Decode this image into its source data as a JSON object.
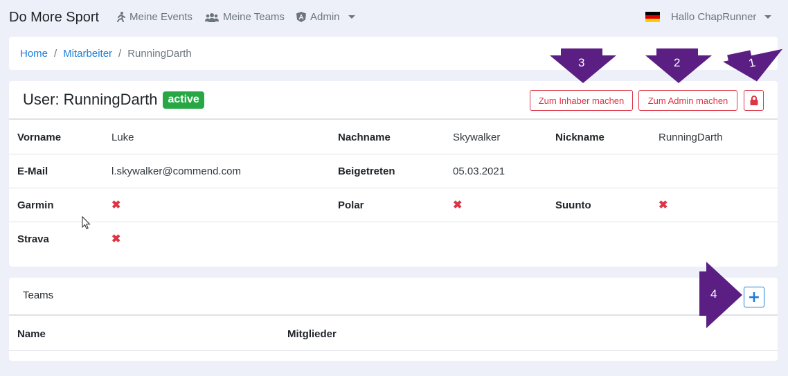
{
  "navbar": {
    "brand": "Do More Sport",
    "events_label": "Meine Events",
    "teams_label": "Meine Teams",
    "admin_label": "Admin",
    "user_greeting": "Hallo ChapRunner",
    "icons": {
      "events": "running-icon",
      "teams": "users-icon",
      "admin": "angular-icon",
      "language": "german-flag-icon"
    }
  },
  "breadcrumb": {
    "home": "Home",
    "employees": "Mitarbeiter",
    "current": "RunningDarth"
  },
  "user": {
    "title": "User: RunningDarth",
    "status": "active",
    "make_owner_label": "Zum Inhaber machen",
    "make_admin_label": "Zum Admin machen",
    "lock_icon": "lock-icon",
    "fields": {
      "firstname_label": "Vorname",
      "firstname": "Luke",
      "lastname_label": "Nachname",
      "lastname": "Skywalker",
      "nickname_label": "Nickname",
      "nickname": "RunningDarth",
      "email_label": "E-Mail",
      "email": "l.skywalker@commend.com",
      "joined_label": "Beigetreten",
      "joined": "05.03.2021",
      "garmin_label": "Garmin",
      "garmin": "✖",
      "polar_label": "Polar",
      "polar": "✖",
      "suunto_label": "Suunto",
      "suunto": "✖",
      "strava_label": "Strava",
      "strava": "✖"
    }
  },
  "teams": {
    "title": "Teams",
    "add_label": "+",
    "col_name": "Name",
    "col_members": "Mitglieder"
  },
  "callouts": [
    "1",
    "2",
    "3",
    "4"
  ],
  "colors": {
    "accent": "#1c7ed6",
    "danger": "#dc3545",
    "success": "#28a745",
    "callout": "#5b1f84",
    "background": "#edf0f8"
  }
}
